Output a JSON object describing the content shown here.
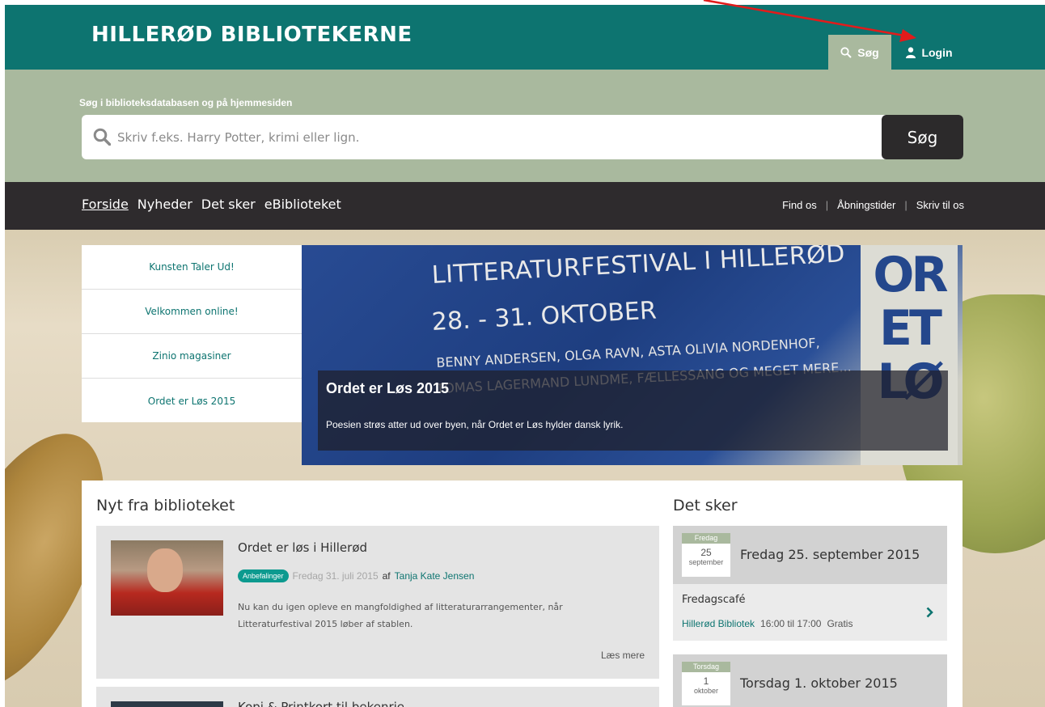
{
  "header": {
    "logo_text": "HILLERØD BIBLIOTEKERNE",
    "search_tab_label": "Søg",
    "login_tab_label": "Login"
  },
  "search": {
    "caption": "Søg i biblioteksdatabasen og på hjemmesiden",
    "placeholder": "Skriv f.eks. Harry Potter, krimi eller lign.",
    "button_label": "Søg"
  },
  "nav": {
    "main": [
      "Forside",
      "Nyheder",
      "Det sker",
      "eBiblioteket"
    ],
    "utility": [
      "Find os",
      "Åbningstider",
      "Skriv til os"
    ]
  },
  "featured": {
    "items": [
      "Kunsten Taler Ud!",
      "Velkommen online!",
      "Zinio magasiner",
      "Ordet er Løs 2015"
    ],
    "banner": {
      "headline1": "LITTERATURFESTIVAL I HILLERØD",
      "headline2": "28. - 31. OKTOBER",
      "line1": "BENNY ANDERSEN, OLGA RAVN, ASTA OLIVIA NORDENHOF,",
      "line2": "TOMAS LAGERMAND LUNDME, FÆLLESSANG OG MEGET MERE...",
      "letters": "OR\nET\nLØ",
      "title": "Ordet er Løs 2015",
      "subtitle": "Poesien strøs atter ud over byen, når Ordet er Løs hylder dansk lyrik."
    }
  },
  "news": {
    "heading": "Nyt fra biblioteket",
    "articles": [
      {
        "title": "Ordet er løs i Hillerød",
        "tag": "Anbefalinger",
        "date": "Fredag 31. juli 2015",
        "by": "af",
        "author": "Tanja Kate Jensen",
        "body": "Nu kan du igen opleve en mangfoldighed af litteraturarrangementer, når Litteraturfestival 2015 løber af stablen.",
        "read_more": "Læs mere"
      },
      {
        "title": "Kopi & Printkort til bekenrie"
      }
    ]
  },
  "events": {
    "heading": "Det sker",
    "dates": [
      {
        "weekday": "Fredag",
        "day": "25",
        "month": "september",
        "title": "Fredag 25. september 2015",
        "event_name": "Fredagscafé",
        "venue": "Hillerød Bibliotek",
        "time": "16:00 til 17:00",
        "price": "Gratis"
      },
      {
        "weekday": "Torsdag",
        "day": "1",
        "month": "oktober",
        "title": "Torsdag 1. oktober 2015"
      }
    ]
  },
  "colors": {
    "brand_teal": "#0d7470",
    "search_band": "#a9b99e",
    "navbar": "#2e2b2d",
    "annotation_arrow": "#e31b1b"
  }
}
